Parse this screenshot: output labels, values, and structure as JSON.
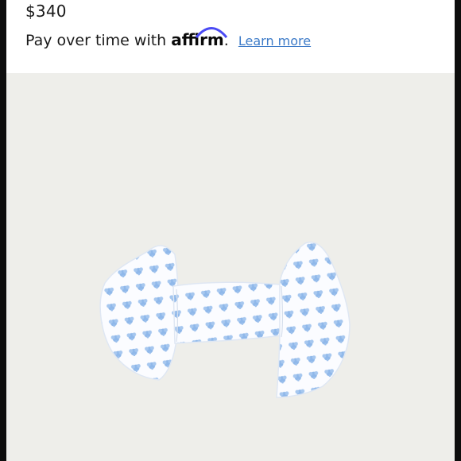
{
  "product": {
    "price": "$340"
  },
  "financing": {
    "text": "Pay over time with",
    "brand": "affirm",
    "period": ".",
    "learn_more_label": "Learn more",
    "brand_color": "#4a4af4",
    "link_color": "#3d7bc8"
  },
  "image": {
    "background_color": "#eeeeea",
    "fabric_pattern_color": "#8fb8ea",
    "icon": "bow-top-garment"
  }
}
